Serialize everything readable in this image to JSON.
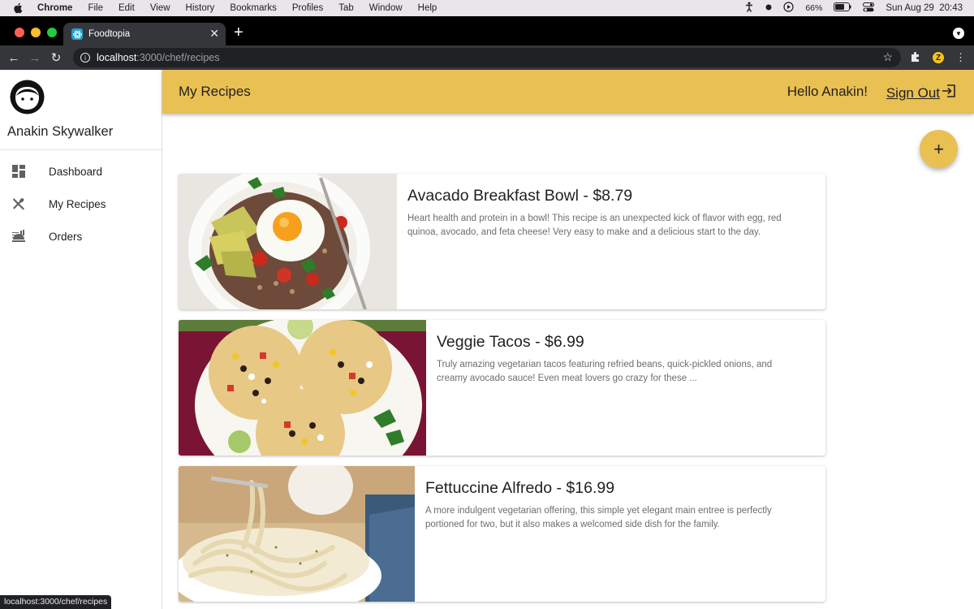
{
  "menubar": {
    "app": "Chrome",
    "items": [
      "File",
      "Edit",
      "View",
      "History",
      "Bookmarks",
      "Profiles",
      "Tab",
      "Window",
      "Help"
    ],
    "battery": "66%",
    "datetime": "Sun Aug 29  20:43"
  },
  "browser": {
    "tab_title": "Foodtopia",
    "url_host": "localhost",
    "url_path": ":3000/chef/recipes",
    "profile_initial": "Z",
    "status_url": "localhost:3000/chef/recipes"
  },
  "sidebar": {
    "user_name": "Anakin Skywalker",
    "items": [
      {
        "label": "Dashboard",
        "icon": "dashboard-icon"
      },
      {
        "label": "My Recipes",
        "icon": "utensils-icon"
      },
      {
        "label": "Orders",
        "icon": "food-service-icon"
      }
    ]
  },
  "header": {
    "title": "My Recipes",
    "greeting": "Hello Anakin!",
    "signout_label": "Sign Out"
  },
  "fab": {
    "label": "+"
  },
  "recipes": [
    {
      "title": "Avacado Breakfast Bowl - $8.79",
      "description": "Heart health and protein in a bowl! This recipe is an unexpected kick of flavor with egg, red quinoa, avocado, and feta cheese! Very easy to make and a delicious start to the day."
    },
    {
      "title": "Veggie Tacos - $6.99",
      "description": "Truly amazing vegetarian tacos featuring refried beans, quick-pickled onions, and creamy avocado sauce! Even meat lovers go crazy for these ..."
    },
    {
      "title": "Fettuccine Alfredo - $16.99",
      "description": "A more indulgent vegetarian offering, this simple yet elegant main entree is perfectly portioned for two, but it also makes a welcomed side dish for the family."
    }
  ],
  "colors": {
    "accent": "#e9c052",
    "sidebar_bg": "#ffffff",
    "text": "#212121"
  }
}
